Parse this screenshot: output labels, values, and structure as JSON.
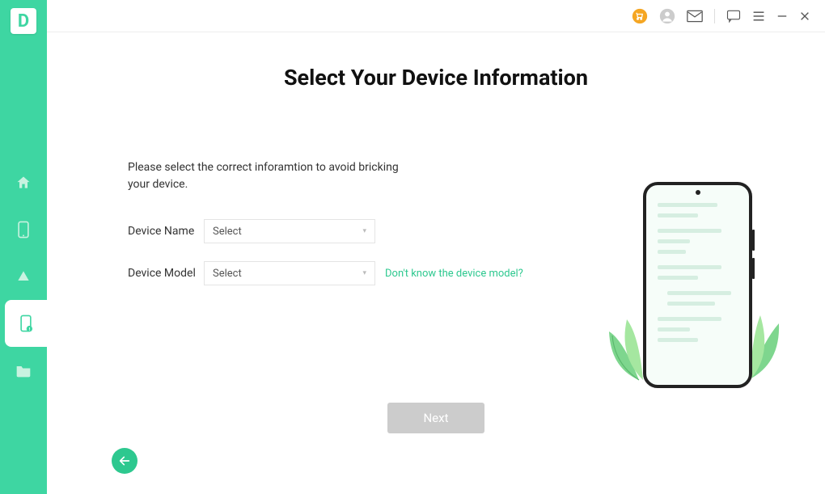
{
  "app_logo": "D",
  "page_title": "Select Your Device Information",
  "instruction": "Please select the correct inforamtion to avoid bricking your device.",
  "form": {
    "device_name_label": "Device Name",
    "device_name_value": "Select",
    "device_model_label": "Device Model",
    "device_model_value": "Select",
    "help_link": "Don't know the device model?"
  },
  "next_button": "Next"
}
